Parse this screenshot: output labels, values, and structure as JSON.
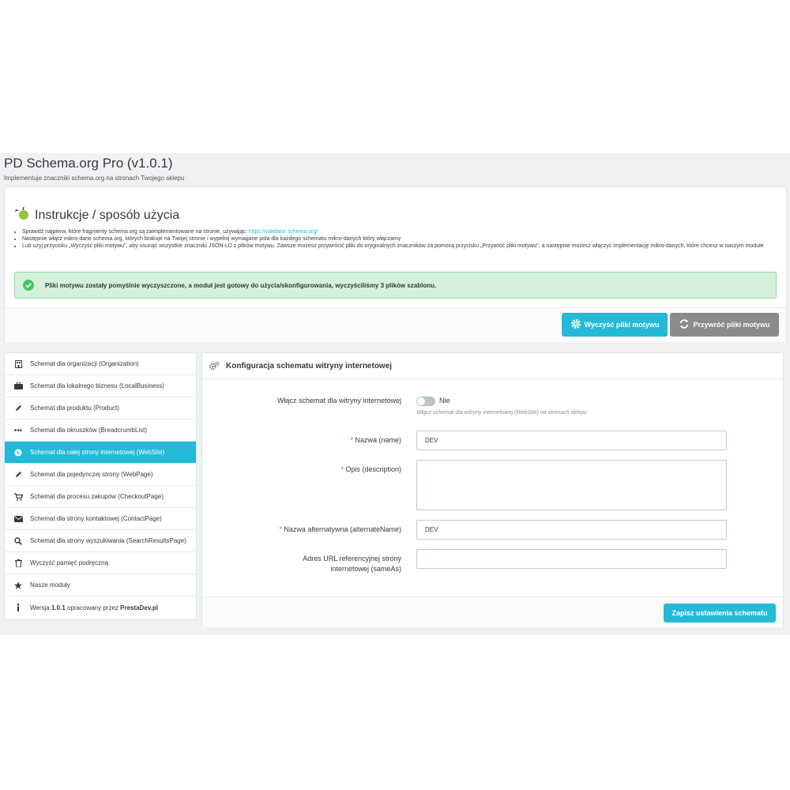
{
  "header": {
    "title": "PD Schema.org Pro (v1.0.1)",
    "subtitle": "Implementuje znaczniki schema.org na stronach Twojego sklepu"
  },
  "instructions": {
    "title": "Instrukcje / sposób użycia",
    "items": [
      {
        "text": "Sprawdź najpierw, które fragmenty schema.org są zaimplementowane na stronie, używając: ",
        "link": "https://validator.schema.org/"
      },
      {
        "text": "Następnie włącz mikro-dane schema.org, których brakuje na Twojej stronie i wypełnij wymagane pola dla każdego schematu mikro-danych który włączamy"
      },
      {
        "text": "Lub użyj przycisku „Wyczyść pliki motywu\", aby usunąć wszystkie znaczniki JSON-LD z plików motywu. Zawsze możesz przywrócić pliki do oryginalnych znaczników za pomocą przycisku „Przywróć pliki motywu\", a następnie możesz włączyć implementację mikro-danych, które chcesz w naszym module"
      }
    ],
    "alert": "Pliki motywu zostały pomyślnie wyczyszczone, a moduł jest gotowy do użycia/skonfigurowania, wyczyściliśmy 3 plików szablonu.",
    "clear_button": "Wyczyść pliki motywu",
    "restore_button": "Przywróć pliki motywu"
  },
  "sidebar": {
    "items": [
      {
        "label": "Schemat dla organizacji (Organization)",
        "icon": "building-icon"
      },
      {
        "label": "Schemat dla lokalnego biznesu (LocalBusiness)",
        "icon": "briefcase-icon"
      },
      {
        "label": "Schemat dla produktu (Product)",
        "icon": "pencil-icon"
      },
      {
        "label": "Schemat dla okruszków (BreadcrumbList)",
        "icon": "ellipsis-icon"
      },
      {
        "label": "Schemat dla całej strony internetowej (WebSite)",
        "icon": "globe-icon",
        "active": true
      },
      {
        "label": "Schemat dla pojedynczej strony (WebPage)",
        "icon": "pencil-icon"
      },
      {
        "label": "Schemat dla procesu zakupów (CheckoutPage)",
        "icon": "cart-icon"
      },
      {
        "label": "Schemat dla strony kontaktowej (ContactPage)",
        "icon": "envelope-icon"
      },
      {
        "label": "Schemat dla strony wyszukiwania (SearchResultsPage)",
        "icon": "search-icon"
      },
      {
        "label": "Wyczyść pamięć podręczną",
        "icon": "trash-icon"
      },
      {
        "label": "Nasze moduły",
        "icon": "star-icon"
      }
    ],
    "version": {
      "prefix": "Wersja ",
      "number": "1.0.1",
      "middle": " opracowany przez ",
      "author": "PrestaDev.pl"
    }
  },
  "config": {
    "title": "Konfiguracja schematu witryny internetowej",
    "enable_label": "Włącz schemat dla witryny internetowej",
    "enable_value": "Nie",
    "enable_help": "Włącz schemat dla witryny internetowej (WebSite) na stronach sklepu",
    "name_label": "Nazwa (name)",
    "name_value": "DEV",
    "description_label": "Opis (description)",
    "description_value": "",
    "alt_name_label": "Nazwa alternatywna (alternateName)",
    "alt_name_value": "DEV",
    "same_as_label_1": "Adres URL referencyjnej strony",
    "same_as_label_2": "internetowej (sameAs)",
    "same_as_value": "",
    "save_button": "Zapisz ustawienia schematu"
  },
  "colors": {
    "accent": "#25b9d7",
    "success_bg": "#d4f2db",
    "success_icon": "#44c66b",
    "required": "#f54c3e"
  }
}
